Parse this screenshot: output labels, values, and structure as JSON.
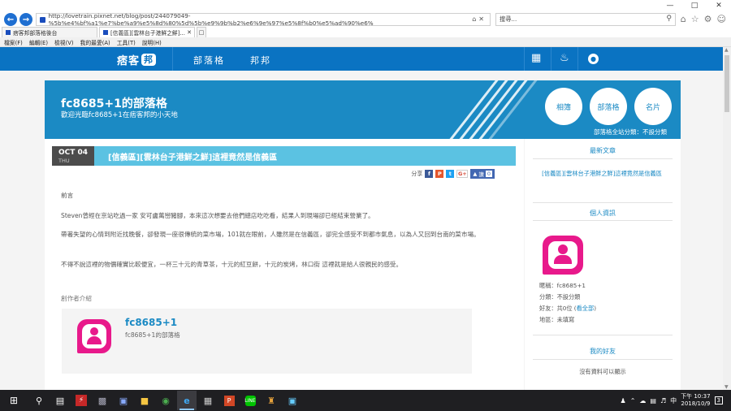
{
  "browser": {
    "url": "http://lovetrain.pixnet.net/blog/post/244079049-%5b%e4%bf%a1%e7%be%a9%e5%8d%80%5d%5b%e9%9b%b2%e6%9e%97%e5%8f%b0%e5%ad%90%e6%",
    "search_placeholder": "搜尋...",
    "tabs": [
      {
        "label": "痞客邦部落格後台"
      },
      {
        "label": "[信義區][雲林台子港鮮之鮮]..."
      }
    ],
    "menu": [
      "檔案(F)",
      "編輯(E)",
      "檢視(V)",
      "我的最愛(A)",
      "工具(T)",
      "說明(H)"
    ]
  },
  "site": {
    "logo": "痞客",
    "logo_box": "邦",
    "nav": [
      "部落格",
      "邦邦"
    ]
  },
  "blog": {
    "title": "fc8685+1的部落格",
    "subtitle": "歡迎光臨fc8685+1在痞客邦的小天地",
    "buttons": [
      "相簿",
      "部落格",
      "名片"
    ],
    "category_line": "部落格全站分類：不設分類"
  },
  "post": {
    "month_day": "OCT 04",
    "weekday": "THU",
    "title": "[信義區][雲林台子港鮮之鮮]這裡竟然是信義區",
    "share_label": "分享",
    "like_label": "讚",
    "like_count": "0",
    "paragraphs": [
      "前言",
      "Steven曾經在京站吃過一家 安可盧萬巒豬腳，本來這次想要去他們總店吃吃看，結果人到現場卻已經結束營業了。",
      "帶著失望的心情到附近找晚餐，卻發現一座很傳統的菜市場，101就在眼前，人雖然是在信義區，卻完全感受不到都市氣息，以為人又回到台南的菜市場。",
      "不得不說這裡的物價確實比較便宜，一杯三十元的青草茶，十元的紅豆餅，十元的炭烤，林口街 這裡就是給人很親民的感受。"
    ],
    "author_label": "創作者介紹",
    "author_name": "fc8685+1",
    "author_sub": "fc8685+1的部落格"
  },
  "sidebar": {
    "latest_heading": "最新文章",
    "latest_item": "[信義區][雲林台子港鮮之鮮]這裡竟然是信義區",
    "profile_heading": "個人資訊",
    "nickname": "暱稱：fc8685+1",
    "category": "分類：不設分類",
    "friends_prefix": "好友：共0位 (",
    "friends_link": "看全部",
    "friends_suffix": ")",
    "region": "地區：未填寫",
    "friends_heading": "我的好友",
    "no_data": "沒有資料可以顯示"
  },
  "taskbar": {
    "time": "下午 10:37",
    "date": "2018/10/9",
    "ime": "中",
    "notif": "3"
  },
  "colors": {
    "brand": "#0a73c2",
    "banner": "#1b8ac4",
    "postbar": "#5bc2e2",
    "avatar": "#e8198b"
  }
}
